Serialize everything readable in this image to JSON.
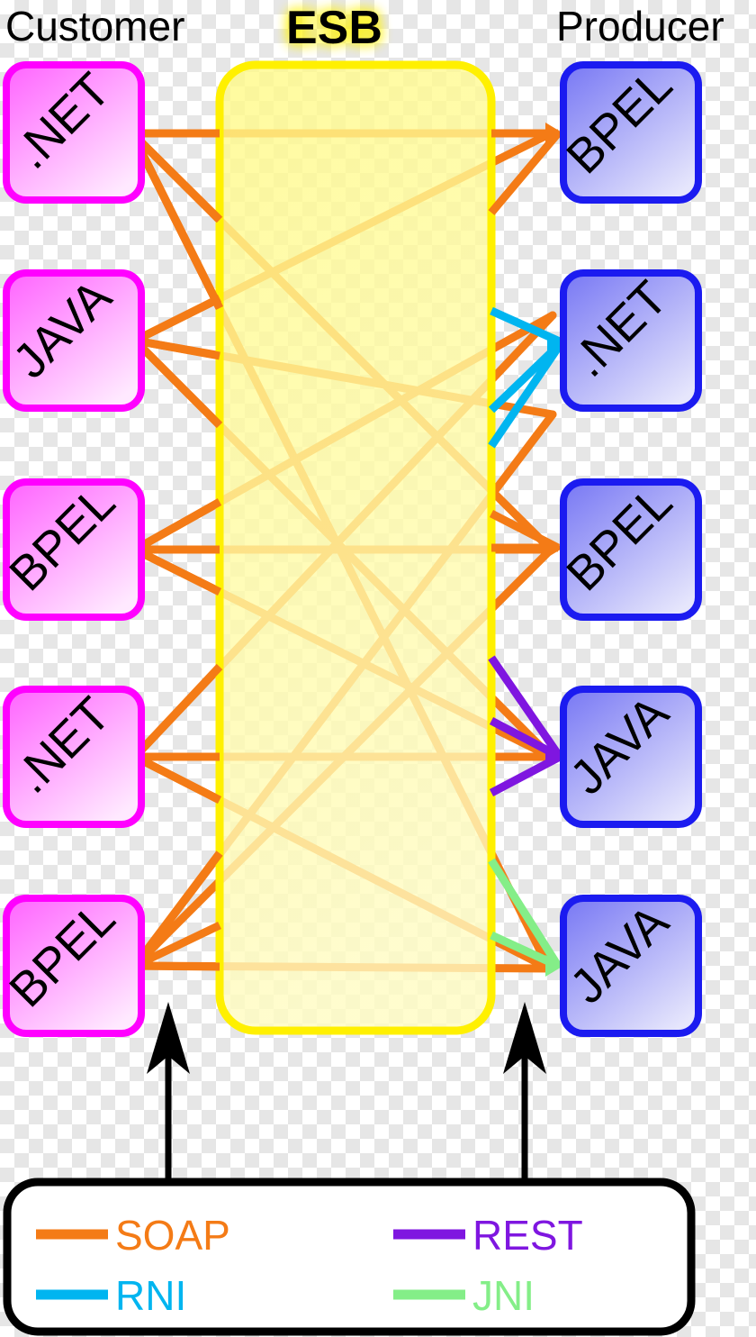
{
  "headers": {
    "left": "Customer",
    "center": "ESB",
    "right": "Producer"
  },
  "colors": {
    "soap": "#F47B16",
    "rni": "#00B5F0",
    "rest": "#7F16E0",
    "jni": "#84EE88",
    "customer_border": "#FF00FF",
    "customer_fill_start": "#FF66FF",
    "customer_fill_end": "#FFE6FF",
    "producer_border": "#1B1BF0",
    "producer_fill_start": "#7B7BF5",
    "producer_fill_end": "#E3E3FB",
    "esb_border": "#FFF000",
    "esb_fill": "#FFF77A",
    "legend_border": "#000000",
    "legend_fill": "#FFFFFF",
    "arrow": "#000000"
  },
  "customer_nodes": [
    {
      "id": "cust-net-1",
      "label": ".NET"
    },
    {
      "id": "cust-java-1",
      "label": "JAVA"
    },
    {
      "id": "cust-bpel-1",
      "label": "BPEL"
    },
    {
      "id": "cust-net-2",
      "label": ".NET"
    },
    {
      "id": "cust-bpel-2",
      "label": "BPEL"
    }
  ],
  "producer_nodes": [
    {
      "id": "prod-bpel-1",
      "label": "BPEL"
    },
    {
      "id": "prod-net-1",
      "label": ".NET"
    },
    {
      "id": "prod-bpel-2",
      "label": "BPEL"
    },
    {
      "id": "prod-java-1",
      "label": "JAVA"
    },
    {
      "id": "prod-java-2",
      "label": "JAVA"
    }
  ],
  "legend": {
    "entries": [
      {
        "id": "legend-soap",
        "label": "SOAP",
        "protocol": "soap"
      },
      {
        "id": "legend-rest",
        "label": "REST",
        "protocol": "rest"
      },
      {
        "id": "legend-rni",
        "label": "RNI",
        "protocol": "rni"
      },
      {
        "id": "legend-jni",
        "label": "JNI",
        "protocol": "jni"
      }
    ]
  },
  "connections": {
    "customer_side_protocol": "soap",
    "producer_side_protocols": [
      "soap",
      "rni",
      "soap",
      "rest",
      "jni"
    ],
    "customer_fanout_per_node": 3,
    "producer_fanin": [
      2,
      3,
      2,
      3,
      2
    ]
  }
}
